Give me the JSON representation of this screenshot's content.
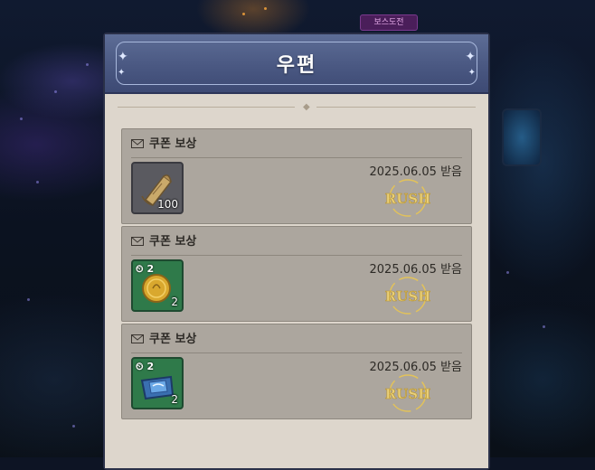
{
  "top_tag": "보스도전",
  "header": {
    "title": "우편"
  },
  "mails": [
    {
      "title": "쿠폰 보상",
      "icon": "mail-envelope-icon",
      "item": "scroll-item-icon",
      "quantity": "100",
      "timer": "",
      "date": "2025.06.05 받음",
      "stamp": "RUSH"
    },
    {
      "title": "쿠폰 보상",
      "icon": "mail-envelope-icon",
      "item": "gold-coin-item-icon",
      "quantity": "2",
      "timer": "2",
      "date": "2025.06.05 받음",
      "stamp": "RUSH"
    },
    {
      "title": "쿠폰 보상",
      "icon": "mail-envelope-icon",
      "item": "blue-crystal-item-icon",
      "quantity": "2",
      "timer": "2",
      "date": "2025.06.05 받음",
      "stamp": "RUSH"
    }
  ],
  "colors": {
    "header_bg": "#4a5882",
    "panel_bg": "#ddd6cc",
    "mail_bg": "#aca69e",
    "stamp_gold": "#e2c25a"
  }
}
